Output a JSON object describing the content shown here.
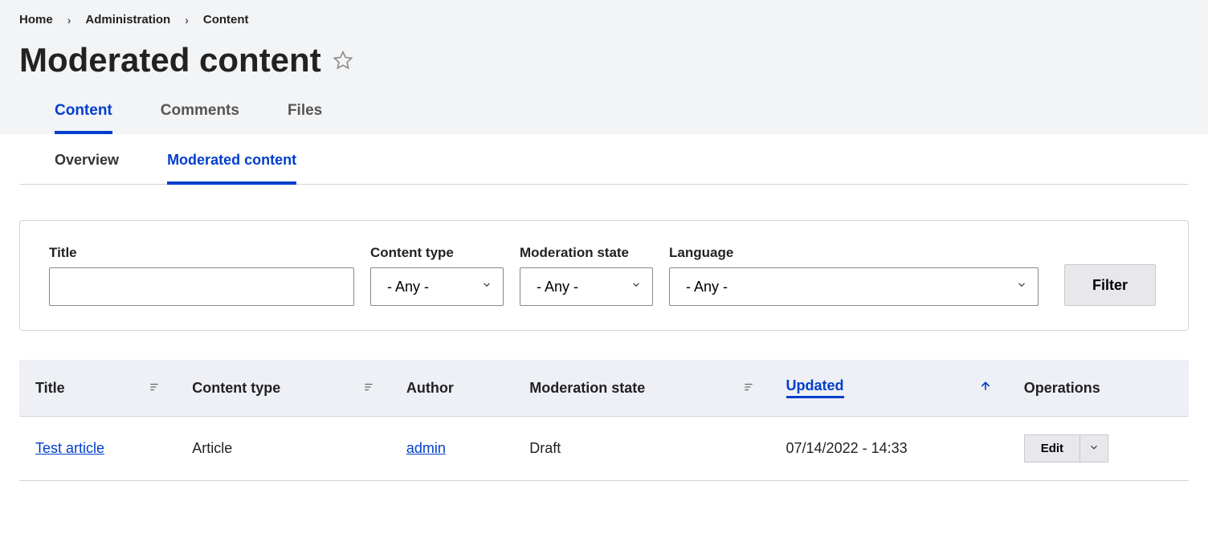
{
  "breadcrumb": {
    "home": "Home",
    "administration": "Administration",
    "content": "Content"
  },
  "page": {
    "title": "Moderated content"
  },
  "tabs_primary": {
    "content": "Content",
    "comments": "Comments",
    "files": "Files"
  },
  "tabs_secondary": {
    "overview": "Overview",
    "moderated": "Moderated content"
  },
  "filters": {
    "title_label": "Title",
    "content_type_label": "Content type",
    "moderation_state_label": "Moderation state",
    "language_label": "Language",
    "any": "- Any -",
    "filter_btn": "Filter"
  },
  "table": {
    "headers": {
      "title": "Title",
      "content_type": "Content type",
      "author": "Author",
      "moderation_state": "Moderation state",
      "updated": "Updated",
      "operations": "Operations"
    },
    "row": {
      "title": "Test article",
      "content_type": "Article",
      "author": "admin",
      "moderation_state": "Draft",
      "updated": "07/14/2022 - 14:33",
      "edit": "Edit"
    }
  }
}
